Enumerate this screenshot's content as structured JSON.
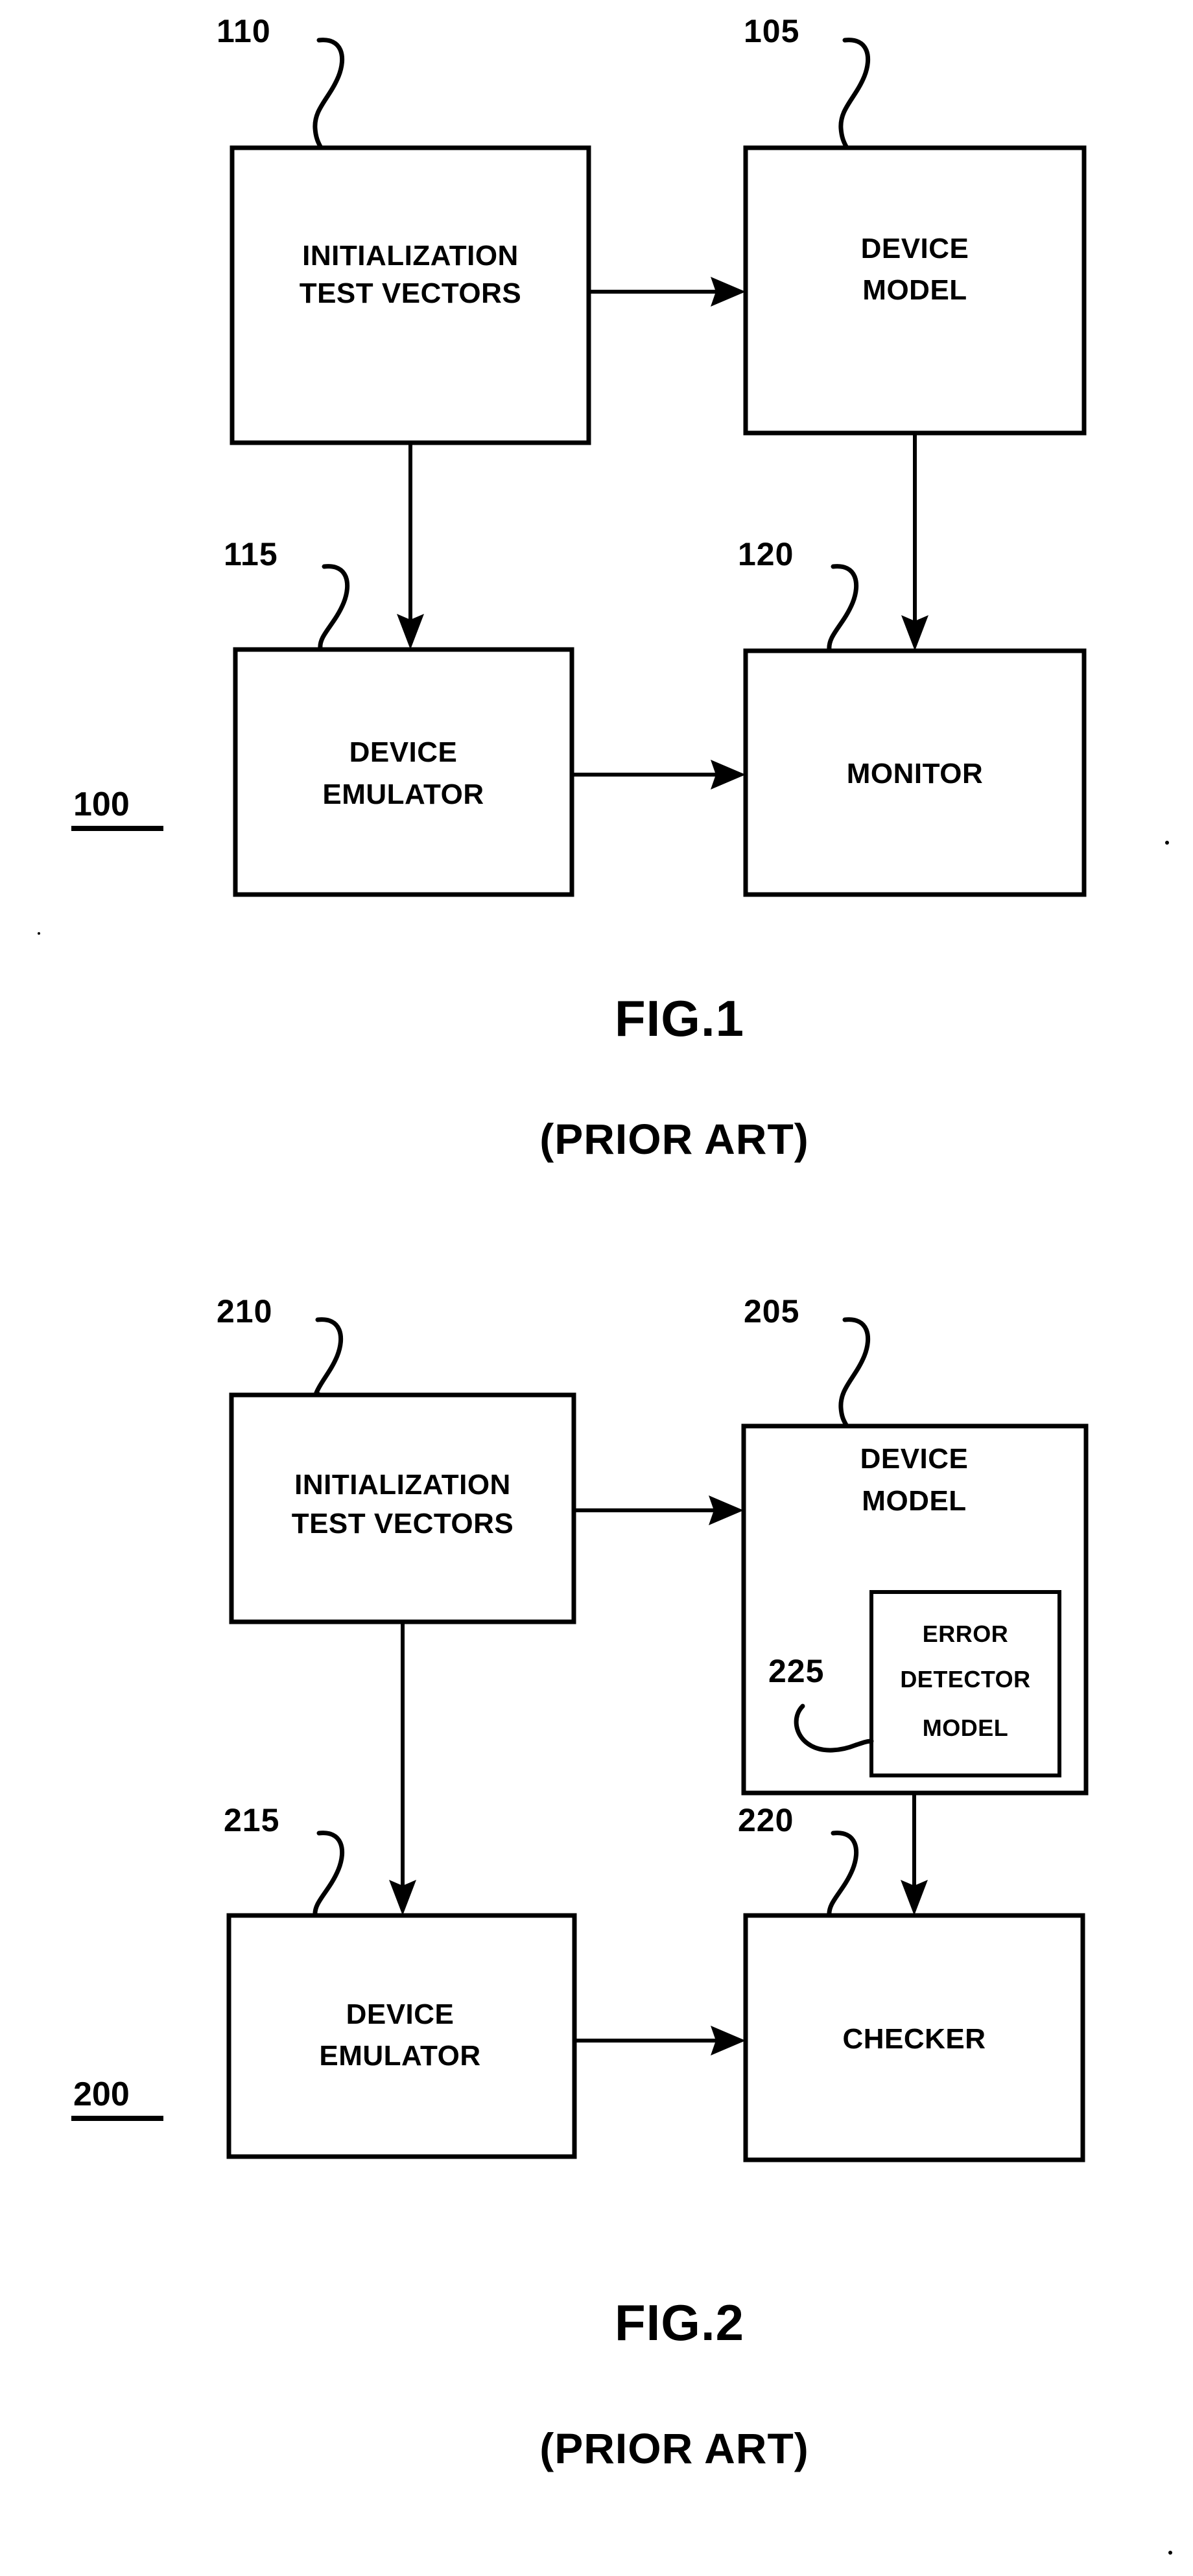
{
  "document": {
    "type": "patent-drawing-sheet",
    "figures": [
      {
        "id": "figure-1",
        "caption": "FIG.1",
        "subcaption": "(PRIOR ART)",
        "system_number": "100",
        "blocks": [
          {
            "ref": "110",
            "line1": "INITIALIZATION",
            "line2": "TEST  VECTORS"
          },
          {
            "ref": "105",
            "line1": "DEVICE",
            "line2": "MODEL"
          },
          {
            "ref": "115",
            "line1": "DEVICE",
            "line2": "EMULATOR"
          },
          {
            "ref": "120",
            "line1": "MONITOR",
            "line2": ""
          }
        ]
      },
      {
        "id": "figure-2",
        "caption": "FIG.2",
        "subcaption": "(PRIOR ART)",
        "system_number": "200",
        "blocks": [
          {
            "ref": "210",
            "line1": "INITIALIZATION",
            "line2": "TEST  VECTORS"
          },
          {
            "ref": "205",
            "line1": "DEVICE",
            "line2": "MODEL"
          },
          {
            "ref": "215",
            "line1": "DEVICE",
            "line2": "EMULATOR"
          },
          {
            "ref": "220",
            "line1": "CHECKER",
            "line2": ""
          }
        ],
        "inner_block": {
          "ref": "225",
          "line1": "ERROR",
          "line2": "DETECTOR",
          "line3": "MODEL"
        }
      }
    ]
  },
  "colors": {
    "ink": "#000000",
    "paper": "#ffffff"
  }
}
